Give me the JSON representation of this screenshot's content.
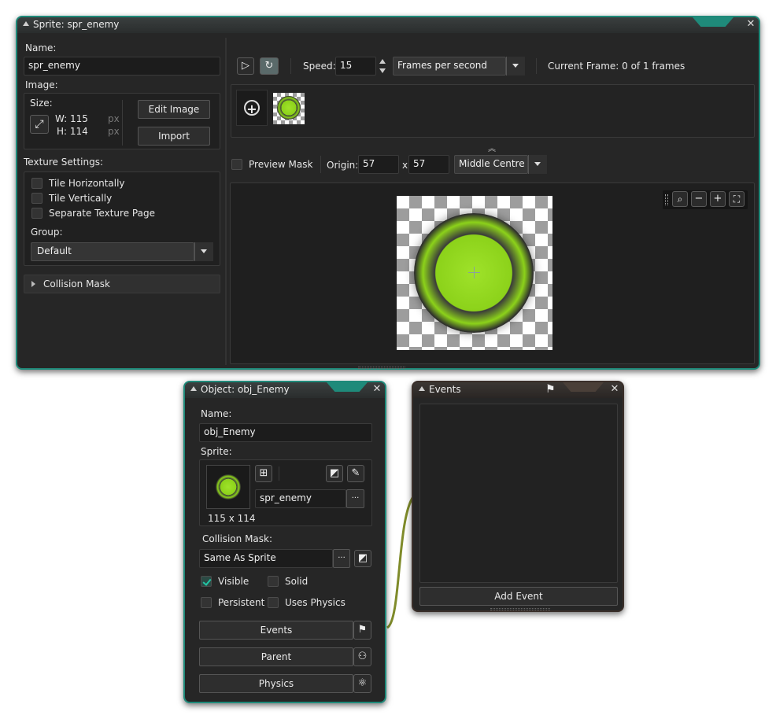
{
  "sprite_window": {
    "title": "Sprite: spr_enemy",
    "name_label": "Name:",
    "name_value": "spr_enemy",
    "image_label": "Image:",
    "size_label": "Size:",
    "width": "W: 115",
    "height": "H: 114",
    "unit": "px",
    "edit_image": "Edit Image",
    "import": "Import",
    "texture_settings_label": "Texture Settings:",
    "tile_horizontally": "Tile Horizontally",
    "tile_vertically": "Tile Vertically",
    "separate_texture_page": "Separate Texture Page",
    "group_label": "Group:",
    "group_value": "Default",
    "collision_mask": "Collision Mask",
    "speed_label": "Speed:",
    "speed_value": "15",
    "speed_mode": "Frames per second",
    "current_frame": "Current Frame: 0 of 1 frames",
    "preview_mask": "Preview Mask",
    "origin_label": "Origin:",
    "origin_x": "57",
    "origin_sep": "x",
    "origin_y": "57",
    "origin_preset": "Middle Centre"
  },
  "object_window": {
    "title": "Object: obj_Enemy",
    "name_label": "Name:",
    "name_value": "obj_Enemy",
    "sprite_label": "Sprite:",
    "sprite_value": "spr_enemy",
    "sprite_size": "115 x 114",
    "collision_mask_label": "Collision Mask:",
    "collision_mask_value": "Same As Sprite",
    "visible": "Visible",
    "solid": "Solid",
    "persistent": "Persistent",
    "uses_physics": "Uses Physics",
    "events_button": "Events",
    "parent_button": "Parent",
    "physics_button": "Physics",
    "ellipsis": "···"
  },
  "events_window": {
    "title": "Events",
    "add_event": "Add Event"
  },
  "icons": {
    "close": "✕",
    "play": "▷",
    "loop": "↻",
    "plus": "+",
    "flag": "⚑",
    "zoom_out": "−",
    "zoom_in": "+"
  },
  "colors": {
    "accent": "#1f8a7a",
    "window_bg": "#262626",
    "check": "#23c6a5"
  }
}
